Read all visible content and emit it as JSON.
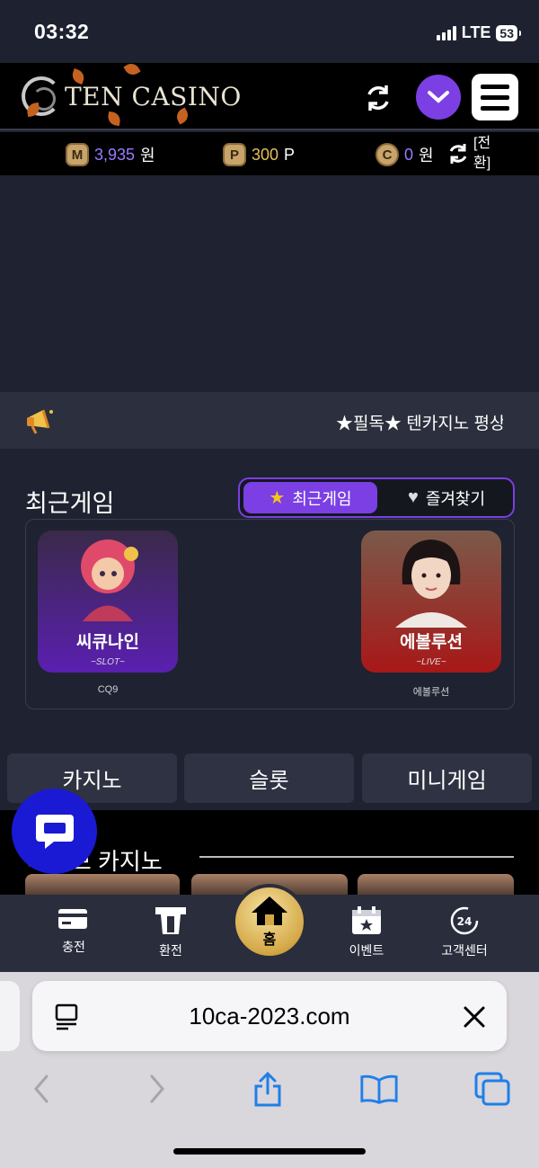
{
  "status": {
    "time": "03:32",
    "network": "LTE",
    "battery": "53"
  },
  "header": {
    "logo_text": "TEN CASINO"
  },
  "balance": {
    "money_icon": "M",
    "money_value": "3,935",
    "money_unit": "원",
    "point_icon": "P",
    "point_value": "300",
    "point_unit": "P",
    "comp_icon": "C",
    "comp_value": "0",
    "comp_unit": "원",
    "exchange_label": "[전환]"
  },
  "notice": {
    "text": "★필독★ 텐카지노 평상"
  },
  "recent": {
    "title": "최근게임",
    "tab_recent": "최근게임",
    "tab_favorites": "즐겨찾기",
    "games": [
      {
        "name": "씨큐나인",
        "tag": "~SLOT~",
        "provider": "CQ9",
        "color_top": "#3a2a4a",
        "color_bottom": "#5a1fb0"
      },
      {
        "name": "에볼루션",
        "tag": "~LIVE~",
        "provider": "에볼루션",
        "color_top": "#7a5a4a",
        "color_bottom": "#a81818"
      }
    ]
  },
  "categories": [
    "카지노",
    "슬롯",
    "미니게임"
  ],
  "live_section": {
    "title": "라이브 카지노"
  },
  "nav": {
    "charge": "충전",
    "withdraw": "환전",
    "home": "홈",
    "event": "이벤트",
    "support": "고객센터"
  },
  "browser": {
    "url": "10ca-2023.com"
  },
  "colors": {
    "accent": "#7b3fe4",
    "background": "#1f2230",
    "chat": "#1a1ad4",
    "gold": "#d4a847"
  }
}
